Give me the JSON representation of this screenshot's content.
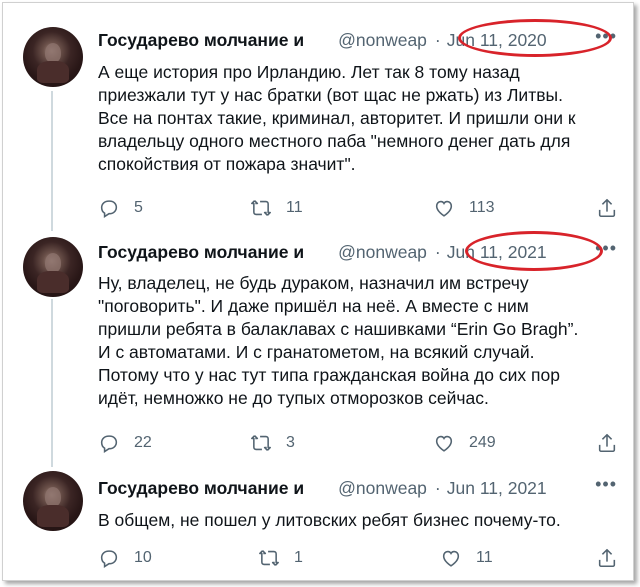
{
  "tweets": [
    {
      "author": "Государево молчание и",
      "handle": "@nonweap",
      "separator": "·",
      "date": "Jun 11, 2020",
      "more": "•••",
      "lines": [
        "А еще история про Ирландию. Лет так 8 тому назад",
        "приезжали тут у нас братки (вот щас не ржать) из Литвы.",
        "Все на понтах такие, криминал, авторитет. И пришли они к",
        "владельцу одного местного паба \"немного денег дать для",
        "спокойствия от пожара значит\"."
      ],
      "replies": "5",
      "retweets": "11",
      "likes": "113"
    },
    {
      "author": "Государево молчание и",
      "handle": "@nonweap",
      "separator": "·",
      "date": "Jun 11, 2021",
      "more": "•••",
      "lines": [
        "Ну, владелец, не будь дураком, назначил им встречу",
        "\"поговорить\". И даже пришёл на неё. А вместе с ним",
        "пришли ребята в балаклавах с нашивками “Erin Go Bragh”.",
        "И с автоматами. И с гранатометом, на всякий случай.",
        "Потому что у нас тут типа гражданская война до сих пор",
        "идёт, немножко не до тупых отморозков сейчас."
      ],
      "replies": "22",
      "retweets": "3",
      "likes": "249"
    },
    {
      "author": "Государево молчание и",
      "handle": "@nonweap",
      "separator": "·",
      "date": "Jun 11, 2021",
      "more": "•••",
      "lines": [
        "В общем, не пошел у литовских ребят бизнес почему-то."
      ],
      "replies": "10",
      "retweets": "1",
      "likes": "11"
    }
  ],
  "annotation_color": "#d8232a",
  "icons": [
    "reply-icon",
    "retweet-icon",
    "like-icon",
    "share-icon"
  ]
}
